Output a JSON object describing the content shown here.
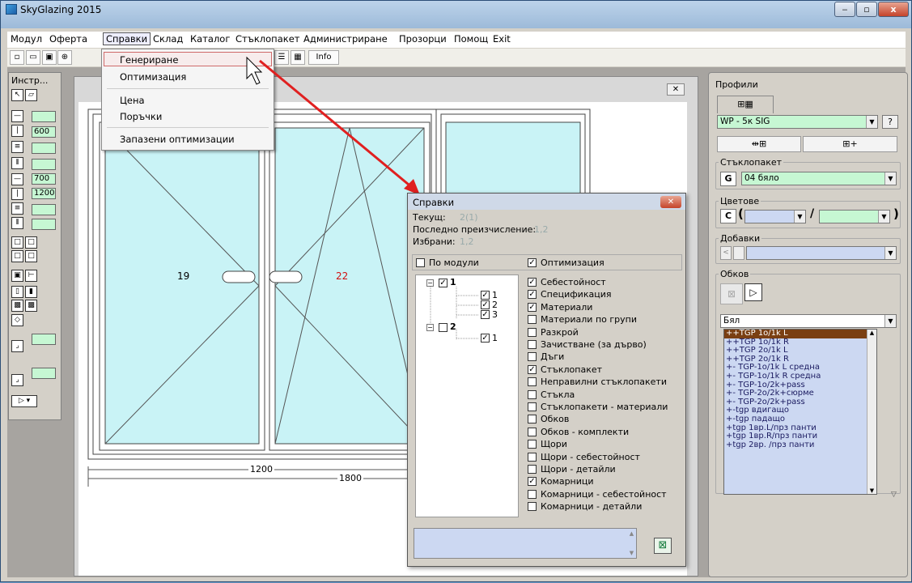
{
  "app": {
    "title": "SkyGlazing 2015"
  },
  "window_controls": {
    "minimize": "‒",
    "maximize": "▫",
    "close": "x"
  },
  "menubar": {
    "items": [
      "Модул",
      "Оферта",
      "Справки",
      "Склад",
      "Каталог",
      "Стъклопакет",
      "Администриране",
      "Прозорци",
      "Помощ",
      "Exit"
    ],
    "active": "Справки"
  },
  "toolbar": {
    "info_label": "Info"
  },
  "dropdown": {
    "items": [
      "Генериране",
      "Оптимизация",
      "Цена",
      "Поръчки",
      "Запазени оптимизации"
    ],
    "highlighted": "Генериране"
  },
  "left_palette": {
    "title": "Инстр...",
    "fields": [
      "600",
      "700",
      "1200"
    ]
  },
  "drawing": {
    "sash_left_number": "19",
    "sash_right_number": "22",
    "dim_inner": "1200",
    "dim_outer": "1800",
    "close_x": "✕"
  },
  "right_panel": {
    "title": "Профили",
    "profile_value": "WP - 5к SIG",
    "help": "?",
    "glass_section": "Стъклопакет",
    "glass_letter": "G",
    "glass_value": "04 бяло",
    "colors_section": "Цветове",
    "colors_letter": "C",
    "colors_open": "(",
    "colors_sep": "/",
    "colors_close": ")",
    "addons_section": "Добавки",
    "hardware_section": "Обков",
    "hardware_filter": "Бял",
    "hardware_items": [
      "++TGP 1o/1k L",
      "++TGP 1o/1k R",
      "++TGP 2o/1k L",
      "++TGP 2o/1k R",
      "+- TGP-1o/1k L средна",
      "+- TGP-1o/1k R средна",
      "+- TGP-1o/2k+pass",
      "+- TGP-2o/2k+сюрме",
      "+- TGP-2o/2k+pass",
      "+-tgp вдигащо",
      "+-tgp падащо",
      "+tgp 1вр.L/прз панти",
      "+tgp 1вр.R/прз панти",
      "+tgp 2вр.  /прз панти"
    ],
    "hardware_selected": 0
  },
  "dialog": {
    "title": "Справки",
    "current_label": "Текущ:",
    "current_value": "2(1)",
    "last_calc_label": "Последно преизчисление:",
    "last_calc_value": "1,2",
    "selected_label": "Избрани:",
    "selected_value": "1,2",
    "by_modules_label": "По модули",
    "by_modules_checked": false,
    "optimization_label": "Оптимизация",
    "optimization_checked": true,
    "tree": [
      {
        "label": "1",
        "checked": true,
        "children": [
          "1",
          "2",
          "3"
        ]
      },
      {
        "label": "2",
        "checked": false,
        "children": [
          "1"
        ]
      }
    ],
    "reports": [
      {
        "label": "Себестойност",
        "checked": true
      },
      {
        "label": "Спецификация",
        "checked": true
      },
      {
        "label": "Материали",
        "checked": true
      },
      {
        "label": "Материали по групи",
        "checked": false
      },
      {
        "label": "Разкрой",
        "checked": false
      },
      {
        "label": "Зачистване (за дърво)",
        "checked": false
      },
      {
        "label": "Дъги",
        "checked": false
      },
      {
        "label": "Стъклопакет",
        "checked": true
      },
      {
        "label": "Неправилни стъклопакети",
        "checked": false
      },
      {
        "label": "Стъкла",
        "checked": false
      },
      {
        "label": "Стъклопакети - материали",
        "checked": false
      },
      {
        "label": "Обков",
        "checked": false
      },
      {
        "label": "Обков - комплекти",
        "checked": false
      },
      {
        "label": "Щори",
        "checked": false
      },
      {
        "label": "Щори - себестойност",
        "checked": false
      },
      {
        "label": "Щори - детайли",
        "checked": false
      },
      {
        "label": "Комарници",
        "checked": true
      },
      {
        "label": "Комарници - себестойност",
        "checked": false
      },
      {
        "label": "Комарници - детайли",
        "checked": false
      }
    ]
  }
}
